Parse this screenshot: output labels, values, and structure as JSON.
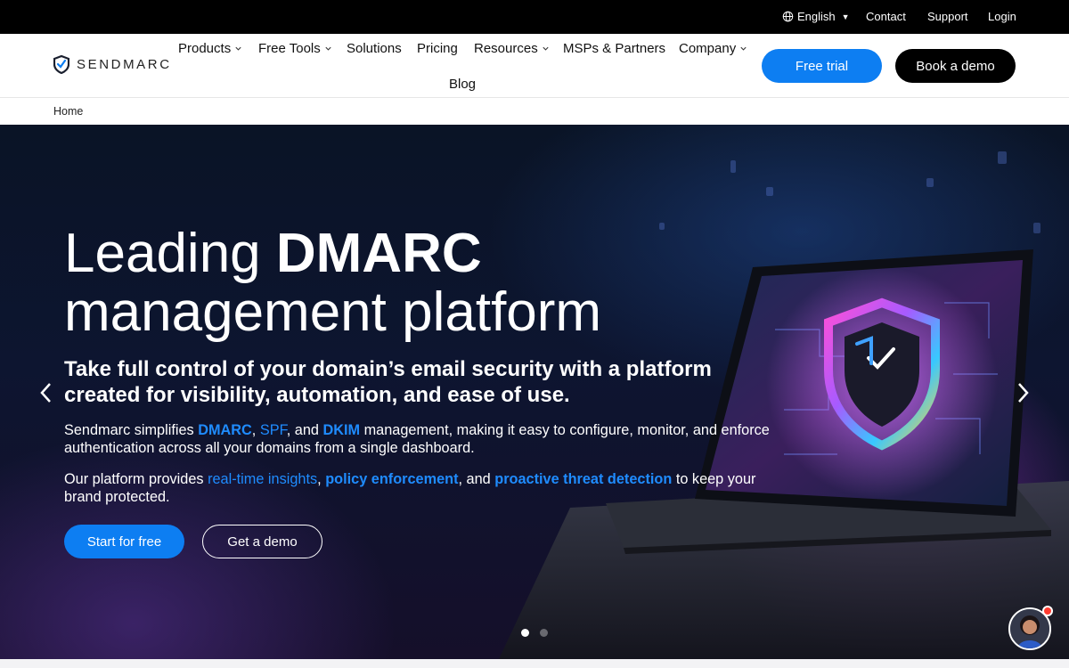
{
  "topbar": {
    "language": "English",
    "links": [
      "Contact",
      "Support",
      "Login"
    ]
  },
  "brand": {
    "name": "SENDMARC",
    "accent": "#0d7ef2"
  },
  "nav": {
    "items": [
      {
        "label": "Products",
        "dropdown": true
      },
      {
        "label": "Free Tools",
        "dropdown": true
      },
      {
        "label": "Solutions",
        "dropdown": false
      },
      {
        "label": "Pricing",
        "dropdown": false
      },
      {
        "label": "Resources",
        "dropdown": true
      },
      {
        "label": "MSPs & Partners",
        "dropdown": false
      },
      {
        "label": "Company",
        "dropdown": true
      },
      {
        "label": "Blog",
        "dropdown": false
      }
    ],
    "cta_primary": "Free trial",
    "cta_secondary": "Book a demo"
  },
  "breadcrumb": {
    "current": "Home"
  },
  "hero": {
    "title_light": "Leading ",
    "title_bold": "DMARC",
    "title_line2": "management platform",
    "subtitle": "Take full control of your domain’s email security with a platform created for visibility, automation, and ease of use.",
    "p1": {
      "pre": "Sendmarc simplifies ",
      "dmarc": "DMARC",
      "sep1": ", ",
      "spf": "SPF",
      "sep2": ", and ",
      "dkim": "DKIM",
      "post": " management, making it easy to configure, monitor, and enforce authentication across all your domains from a single dashboard."
    },
    "p2": {
      "pre": "Our platform provides ",
      "insights": "real-time insights",
      "sep1": ", ",
      "policy": "policy enforcement",
      "sep2": ", and ",
      "threat": "proactive threat detection",
      "post": " to keep your brand protected."
    },
    "btn_start": "Start for free",
    "btn_demo": "Get a demo",
    "slides": {
      "total": 2,
      "active": 1
    }
  },
  "icons": {
    "globe": "globe-icon",
    "prev": "chevron-left-icon",
    "next": "chevron-right-icon",
    "chat": "chat-avatar-icon"
  }
}
